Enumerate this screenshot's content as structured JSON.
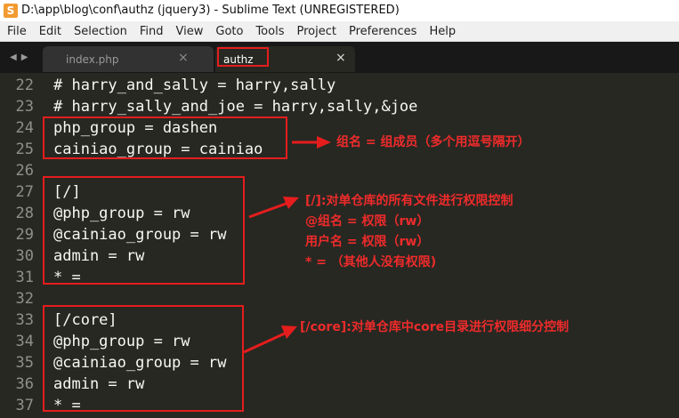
{
  "window": {
    "app_icon": "S",
    "title": "D:\\app\\blog\\conf\\authz (jquery3) - Sublime Text (UNREGISTERED)"
  },
  "menu": [
    "File",
    "Edit",
    "Selection",
    "Find",
    "View",
    "Goto",
    "Tools",
    "Project",
    "Preferences",
    "Help"
  ],
  "tabs": [
    {
      "label": "index.php",
      "active": false,
      "close": "×"
    },
    {
      "label": "authz",
      "active": true,
      "close": "×"
    }
  ],
  "tab_nav": "◀▶",
  "lines": [
    {
      "num": "22",
      "text": "# harry_and_sally = harry,sally"
    },
    {
      "num": "23",
      "text": "# harry_sally_and_joe = harry,sally,&joe"
    },
    {
      "num": "24",
      "text": "php_group = dashen"
    },
    {
      "num": "25",
      "text": "cainiao_group = cainiao"
    },
    {
      "num": "26",
      "text": ""
    },
    {
      "num": "27",
      "text": "[/]"
    },
    {
      "num": "28",
      "text": "@php_group = rw"
    },
    {
      "num": "29",
      "text": "@cainiao_group = rw"
    },
    {
      "num": "30",
      "text": "admin = rw"
    },
    {
      "num": "31",
      "text": "* ="
    },
    {
      "num": "32",
      "text": ""
    },
    {
      "num": "33",
      "text": "[/core]"
    },
    {
      "num": "34",
      "text": "@php_group = rw"
    },
    {
      "num": "35",
      "text": "@cainiao_group = rw"
    },
    {
      "num": "36",
      "text": "admin = rw"
    },
    {
      "num": "37",
      "text": "* ="
    }
  ],
  "annotations": {
    "groups_note": "组名 = 组成员（多个用逗号隔开）",
    "root_notes": [
      "[/]:对单仓库的所有文件进行权限控制",
      "@组名 = 权限（rw）",
      "用户名 = 权限（rw）",
      "* = （其他人没有权限)"
    ],
    "core_note": "[/core]:对单仓库中core目录进行权限细分控制"
  },
  "colors": {
    "editor_bg": "#272822",
    "annotation_red": "#e51d1d",
    "code_text": "#f8f8f2",
    "gutter_text": "#90908a"
  }
}
